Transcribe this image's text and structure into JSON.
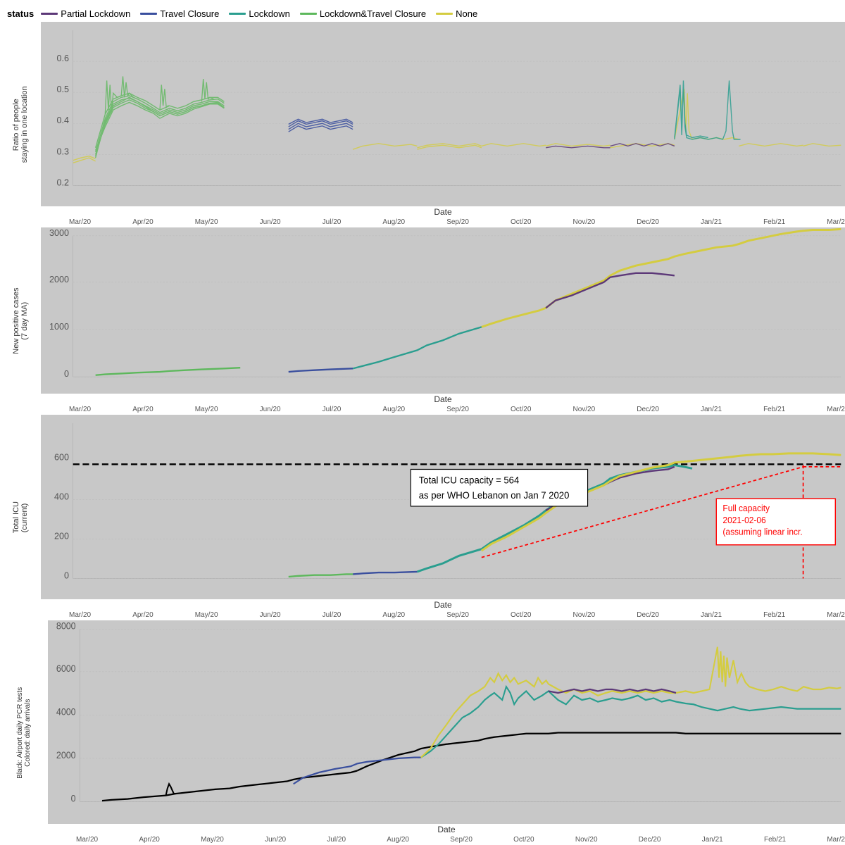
{
  "legend": {
    "status_label": "status",
    "items": [
      {
        "label": "Partial Lockdown",
        "color": "#5c3878"
      },
      {
        "label": "Travel Closure",
        "color": "#3a4f9e"
      },
      {
        "label": "Lockdown",
        "color": "#2a9e8f"
      },
      {
        "label": "Lockdown&Travel Closure",
        "color": "#5db85c"
      },
      {
        "label": "None",
        "color": "#d4cc40"
      }
    ]
  },
  "charts": [
    {
      "id": "chart1",
      "y_label": "Ratio of people\nstaying in one location",
      "x_label": "Date",
      "y_ticks": [
        "0.2",
        "0.3",
        "0.4",
        "0.5",
        "0.6"
      ],
      "x_ticks": [
        "Mar/20",
        "Apr/20",
        "May/20",
        "Jun/20",
        "Jul/20",
        "Aug/20",
        "Sep/20",
        "Oct/20",
        "Nov/20",
        "Dec/20",
        "Jan/21",
        "Feb/21",
        "Mar/2"
      ]
    },
    {
      "id": "chart2",
      "y_label": "New positive cases\n(7 day MA)",
      "x_label": "Date",
      "y_ticks": [
        "0",
        "1000",
        "2000",
        "3000"
      ],
      "x_ticks": [
        "Mar/20",
        "Apr/20",
        "May/20",
        "Jun/20",
        "Jul/20",
        "Aug/20",
        "Sep/20",
        "Oct/20",
        "Nov/20",
        "Dec/20",
        "Jan/21",
        "Feb/21",
        "Mar/2"
      ]
    },
    {
      "id": "chart3",
      "y_label": "Total ICU\n(current)",
      "x_label": "Date",
      "y_ticks": [
        "0",
        "200",
        "400",
        "600"
      ],
      "x_ticks": [
        "Mar/20",
        "Apr/20",
        "May/20",
        "Jun/20",
        "Jul/20",
        "Aug/20",
        "Sep/20",
        "Oct/20",
        "Nov/20",
        "Dec/20",
        "Jan/21",
        "Feb/21",
        "Mar/2"
      ],
      "annotation_icu": "Total ICU capacity = 564\nas per WHO Lebanon on Jan 7 2020",
      "annotation_capacity": "Full capacity\n2021-02-06\n(assuming linear incr."
    },
    {
      "id": "chart4",
      "y_label": "Black: Airport daily PCR tests\nColored: daily arrivals",
      "x_label": "Date",
      "y_ticks": [
        "0",
        "2000",
        "4000",
        "6000",
        "8000"
      ],
      "x_ticks": [
        "Mar/20",
        "Apr/20",
        "May/20",
        "Jun/20",
        "Jul/20",
        "Aug/20",
        "Sep/20",
        "Oct/20",
        "Nov/20",
        "Dec/20",
        "Jan/21",
        "Feb/21",
        "Mar/2"
      ]
    }
  ]
}
